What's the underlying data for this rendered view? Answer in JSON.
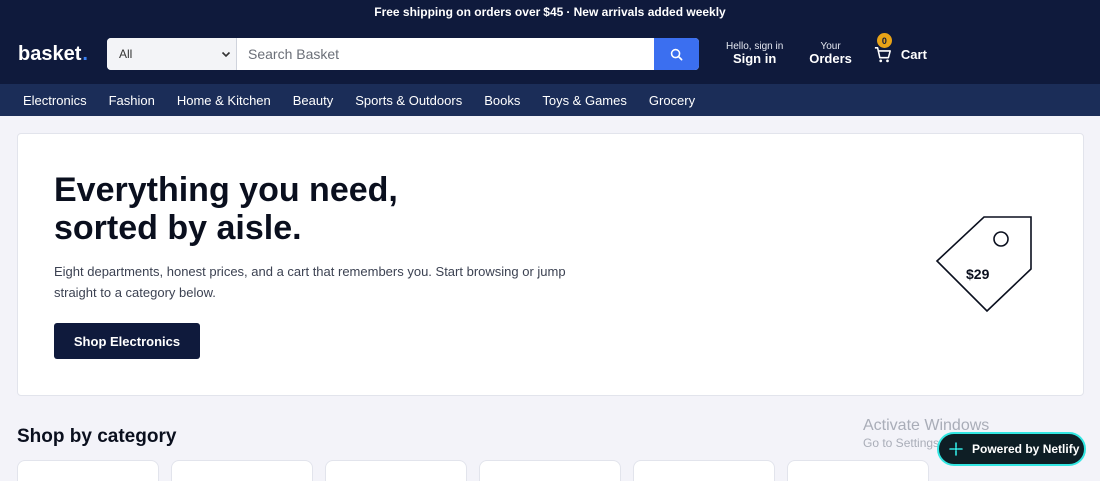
{
  "promo": {
    "text_before": "Free shipping on orders over",
    "amount": "$45",
    "text_after": "· New arrivals added weekly"
  },
  "header": {
    "logo_text": "basket",
    "logo_dot": ".",
    "search": {
      "category_selected": "All",
      "placeholder": "Search Basket",
      "value": ""
    },
    "account": {
      "line1": "Hello, sign in",
      "line2": "Sign in"
    },
    "orders": {
      "line1": "Your",
      "line2": "Orders"
    },
    "cart": {
      "count": "0",
      "label": "Cart"
    }
  },
  "nav": {
    "items": [
      "Electronics",
      "Fashion",
      "Home & Kitchen",
      "Beauty",
      "Sports & Outdoors",
      "Books",
      "Toys & Games",
      "Grocery"
    ]
  },
  "hero": {
    "title_line1": "Everything you need,",
    "title_line2": "sorted by aisle.",
    "description": "Eight departments, honest prices, and a cart that remembers you. Start browsing or jump straight to a category below.",
    "cta": "Shop Electronics",
    "price_tag": "$29"
  },
  "categories_section": {
    "title": "Shop by category"
  },
  "overlay": {
    "watermark_line1": "Activate Windows",
    "watermark_line2": "Go to Settings to activate Windows.",
    "netlify_badge": "Powered by Netlify"
  },
  "colors": {
    "header_bg": "#0f1a3c",
    "nav_bg": "#1b2d58",
    "accent_blue": "#3b6ff0",
    "cart_badge": "#e8a317",
    "page_bg": "#f3f3f9"
  },
  "icons": {
    "search": "search-icon",
    "dropdown": "chevron-down-icon",
    "cart": "cart-icon",
    "netlify": "netlify-icon"
  }
}
